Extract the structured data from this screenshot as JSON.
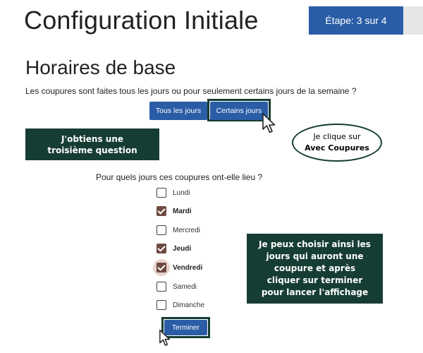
{
  "header": {
    "title": "Configuration Initiale",
    "step": "Étape: 3 sur 4"
  },
  "section": {
    "title": "Horaires de base",
    "question": "Les coupures sont faites tous les jours ou pour seulement certains jours de la semaine ?",
    "options": {
      "all_days": "Tous les jours",
      "some_days": "Certains jours"
    }
  },
  "annotations": {
    "third_question": "J'obtiens une troisième question",
    "click_prefix": "Je clique sur",
    "click_target": "Avec Coupures",
    "choose_days": "Je peux choisir ainsi les jours qui auront une coupure et après cliquer sur terminer pour lancer l'affichage"
  },
  "days_question": "Pour quels jours ces coupures ont-elle lieu ?",
  "days": [
    {
      "label": "Lundi",
      "checked": false
    },
    {
      "label": "Mardi",
      "checked": true
    },
    {
      "label": "Mercredi",
      "checked": false
    },
    {
      "label": "Jeudi",
      "checked": true
    },
    {
      "label": "Vendredi",
      "checked": true
    },
    {
      "label": "Samedi",
      "checked": false
    },
    {
      "label": "Dimanche",
      "checked": false
    }
  ],
  "finish_button": "Terminer",
  "colors": {
    "primary": "#2a5da6",
    "note_bg": "#163d33",
    "checkbox_checked": "#6e4a40"
  }
}
